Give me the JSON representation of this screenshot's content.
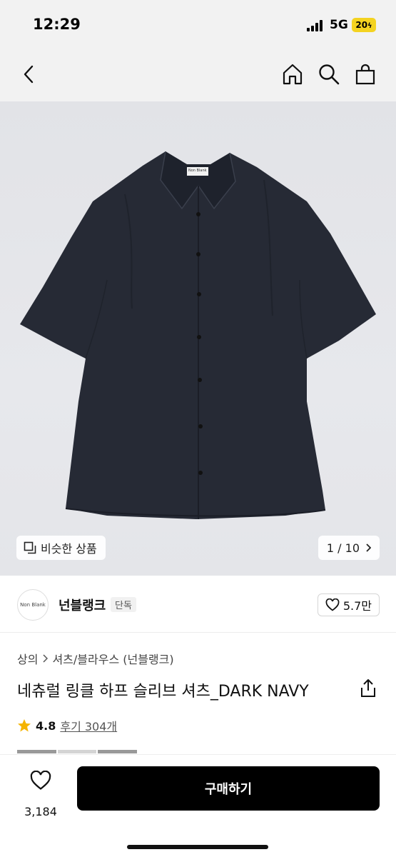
{
  "status_bar": {
    "time": "12:29",
    "network": "5G",
    "battery": "20"
  },
  "nav": {
    "icons": [
      "back-arrow-icon",
      "home-icon",
      "search-icon",
      "shopping-bag-icon"
    ]
  },
  "image": {
    "label_text": "Non Blank",
    "similar_label": "비슷한 상품",
    "counter": "1 / 10"
  },
  "brand": {
    "logo_text": "Non Blank",
    "name": "넌블랭크",
    "badge": "단독",
    "likes": "5.7만"
  },
  "product": {
    "breadcrumb_1": "상의",
    "breadcrumb_2": "셔츠/블라우스 (넌블랭크)",
    "title": "네츄럴 링클 하프 슬리브 셔츠_DARK NAVY",
    "rating": "4.8",
    "reviews": "후기 304개"
  },
  "bottom": {
    "wish_count": "3,184",
    "buy_label": "구매하기"
  },
  "colors": {
    "accent": "#000000",
    "star": "#f5b400",
    "shirt": "#262a35",
    "badge": "#f4d321"
  }
}
